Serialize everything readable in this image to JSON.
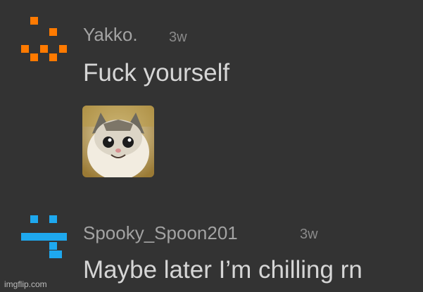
{
  "comments": [
    {
      "username": "Yakko.",
      "time": "3w",
      "text": "Fuck yourself",
      "avatar_color": "#ff7a00",
      "attachment_icon": "smiling-cat-photo"
    },
    {
      "username": "Spooky_Spoon201",
      "time": "3w",
      "text": "Maybe later I’m chilling rn",
      "avatar_color": "#1ea8ee"
    }
  ],
  "watermark": "imgflip.com"
}
